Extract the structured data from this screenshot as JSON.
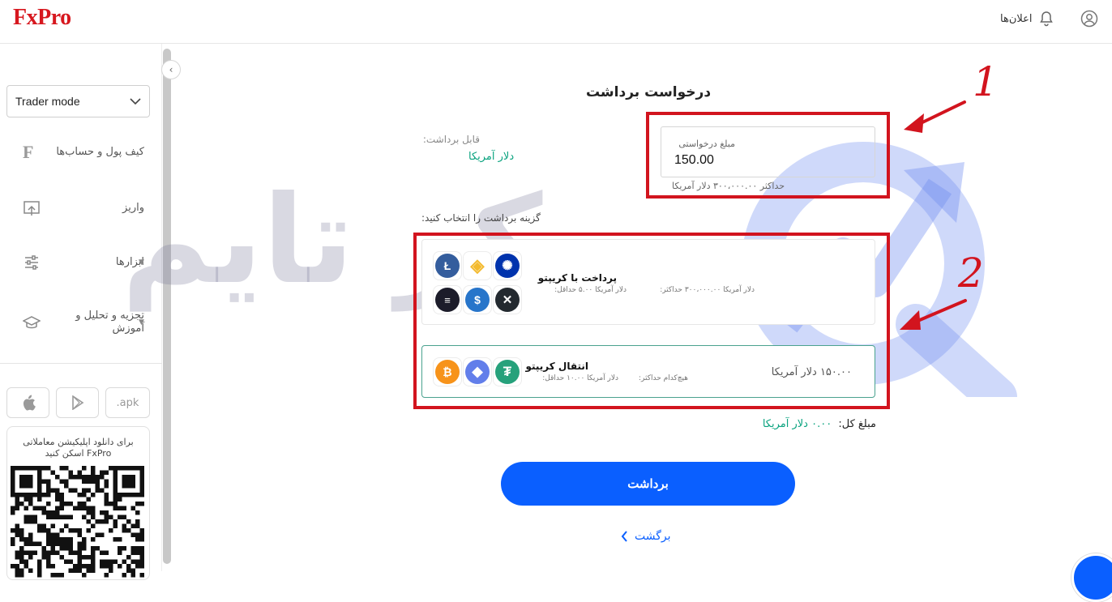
{
  "header": {
    "logo": "FxPro",
    "notifications_label": "اعلان‌ها"
  },
  "sidebar": {
    "mode_select": "Trader mode",
    "items": [
      {
        "label": "کیف پول و حساب‌ها",
        "icon": "wallet-f-icon"
      },
      {
        "label": "واریز",
        "icon": "deposit-icon"
      },
      {
        "label": "ابزارها",
        "icon": "sliders-icon"
      },
      {
        "label": "تجزیه و تحلیل و آموزش",
        "icon": "graduation-cap-icon"
      }
    ],
    "apps": {
      "apple": "apple-icon",
      "android": "google-play-icon",
      "apk": ".apk"
    },
    "qr_text": "برای دانلود اپلیکیشن معاملاتی FxPro اسکن کنید"
  },
  "main": {
    "title": "درخواست برداشت",
    "amount": {
      "label": "مبلغ درخواستی",
      "value": "150.00",
      "hint": "حداکثر ۳۰۰،۰۰۰.۰۰ دلار آمریکا"
    },
    "available": {
      "label": "قابل برداشت:",
      "value": "دلار آمریکا"
    },
    "choose_label": "گزینه برداشت را انتخاب کنید:",
    "options": [
      {
        "title": "پرداخت با کریپتو",
        "max": "دلار آمریکا ۳۰۰،۰۰۰.۰۰ حداکثر:",
        "min": "دلار آمریکا ۵.۰۰ حداقل:",
        "coins": [
          "litecoin",
          "binance",
          "cardano",
          "solana",
          "usdc",
          "xrp"
        ]
      },
      {
        "title": "انتقال کریپتو",
        "max": "هیچ‌کدام حداکثر:",
        "min": "دلار آمریکا ۱۰.۰۰ حداقل:",
        "amount": "۱۵۰.۰۰ دلار آمریکا",
        "coins": [
          "bitcoin",
          "ethereum",
          "tether"
        ]
      }
    ],
    "total": {
      "label": "مبلغ کل:",
      "value": "۰.۰۰ دلار آمریکا"
    },
    "submit_label": "برداشت",
    "back_label": "برگشت"
  },
  "annotations": {
    "num1": "1",
    "num2": "2"
  },
  "watermark": "بروکر تایم",
  "colors": {
    "brand_red": "#d7181f",
    "primary_blue": "#0a5fff",
    "accent_green": "#0aa37f",
    "annotation_red": "#d2141e"
  }
}
